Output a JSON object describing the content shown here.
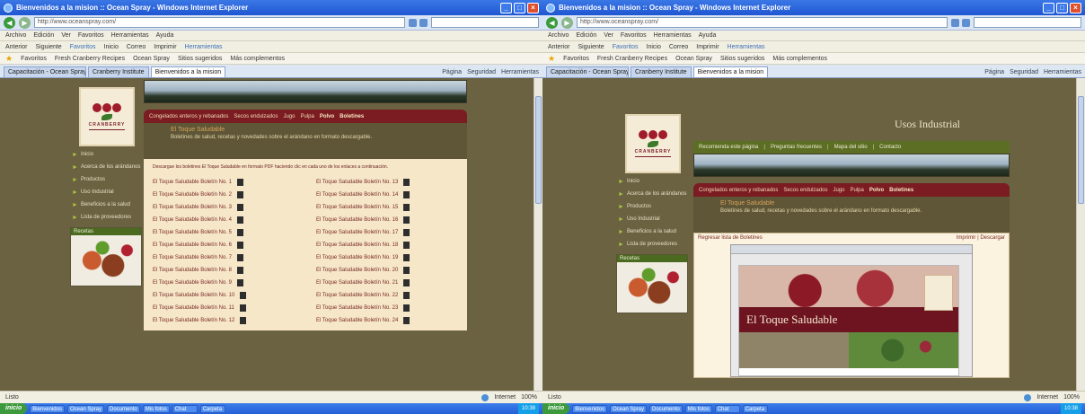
{
  "colors": {
    "page_bg": "#6b6242",
    "menu_red": "#7b1c22",
    "nav_green": "#5c6e24",
    "paper": "#f6e7c9",
    "titlebar_blue": "#245fd8"
  },
  "windows": [
    {
      "title": "Bienvenidos a la mision :: Ocean Spray - Windows Internet Explorer",
      "url": "http://www.oceanspray.com/",
      "menu": [
        "Archivo",
        "Edición",
        "Ver",
        "Favoritos",
        "Herramientas",
        "Ayuda"
      ],
      "toolbar": [
        "Anterior",
        "Siguiente",
        "Favoritos",
        "Inicio",
        "Correo",
        "Imprimir",
        "Herramientas"
      ],
      "favorites": [
        "Favoritos",
        "Fresh Cranberry Recipes",
        "Ocean Spray",
        "Sitios sugeridos",
        "Más complementos"
      ],
      "tabs": [
        "Capacitación - Ocean Spray",
        "Cranberry Institute",
        "Bienvenidos a la mision"
      ],
      "tab_tools": [
        "Página",
        "Seguridad",
        "Herramientas"
      ],
      "status_left": "Listo",
      "status_zone": "Internet",
      "status_zoom": "100%"
    },
    {
      "title": "Bienvenidos a la mision :: Ocean Spray - Windows Internet Explorer",
      "url": "http://www.oceanspray.com/",
      "menu": [
        "Archivo",
        "Edición",
        "Ver",
        "Favoritos",
        "Herramientas",
        "Ayuda"
      ],
      "toolbar": [
        "Anterior",
        "Siguiente",
        "Favoritos",
        "Inicio",
        "Correo",
        "Imprimir",
        "Herramientas"
      ],
      "favorites": [
        "Favoritos",
        "Fresh Cranberry Recipes",
        "Ocean Spray",
        "Sitios sugeridos",
        "Más complementos"
      ],
      "tabs": [
        "Capacitación - Ocean Spray",
        "Cranberry Institute",
        "Bienvenidos a la mision"
      ],
      "tab_tools": [
        "Página",
        "Seguridad",
        "Herramientas"
      ],
      "status_left": "Listo",
      "status_zone": "Internet",
      "status_zoom": "100%"
    }
  ],
  "site": {
    "logo_text": "CRANBERRY",
    "sidebar": [
      "Inicio",
      "Acerca de los arándanos",
      "Productos",
      "Uso Industrial",
      "Beneficios a la salud",
      "Lista de proveedores"
    ],
    "recetas": "Recetas",
    "menu": [
      "Congelados enteros y rebanados",
      "Secos endulzados",
      "Jugo",
      "Pulpa",
      "Polvo",
      "Boletines"
    ],
    "section_title": "El Toque Saludable",
    "section_desc": "Boletines de salud, recetas y novedades sobre el arándano en formato descargable.",
    "intro": "Descargue los boletines El Toque Saludable en formato PDF haciendo clic en cada uno de los enlaces a continuación.",
    "bulletins_left": [
      "El Toque Saludable Boletín No. 1",
      "El Toque Saludable Boletín No. 2",
      "El Toque Saludable Boletín No. 3",
      "El Toque Saludable Boletín No. 4",
      "El Toque Saludable Boletín No. 5",
      "El Toque Saludable Boletín No. 6",
      "El Toque Saludable Boletín No. 7",
      "El Toque Saludable Boletín No. 8",
      "El Toque Saludable Boletín No. 9",
      "El Toque Saludable Boletín No. 10",
      "El Toque Saludable Boletín No. 11",
      "El Toque Saludable Boletín No. 12"
    ],
    "bulletins_right": [
      "El Toque Saludable Boletín No. 13",
      "El Toque Saludable Boletín No. 14",
      "El Toque Saludable Boletín No. 15",
      "El Toque Saludable Boletín No. 16",
      "El Toque Saludable Boletín No. 17",
      "El Toque Saludable Boletín No. 18",
      "El Toque Saludable Boletín No. 19",
      "El Toque Saludable Boletín No. 20",
      "El Toque Saludable Boletín No. 21",
      "El Toque Saludable Boletín No. 22",
      "El Toque Saludable Boletín No. 23",
      "El Toque Saludable Boletín No. 24"
    ],
    "page_title_right": "Usos Industrial",
    "topnav": [
      "Recomienda este página",
      "Preguntas frecuentes",
      "Mapa del sitio",
      "Contacto"
    ],
    "viewer_back": "Regresar lista de Boletines",
    "viewer_actions": "Imprimir  |  Descargar",
    "toque_title": "El Toque Saludable"
  },
  "taskbar": {
    "start": "inicio",
    "tasks": [
      "Bienvenidos",
      "Ocean Spray",
      "Documento",
      "Mis fotos",
      "Chat",
      "Carpeta"
    ],
    "tray_time": "10:38"
  }
}
